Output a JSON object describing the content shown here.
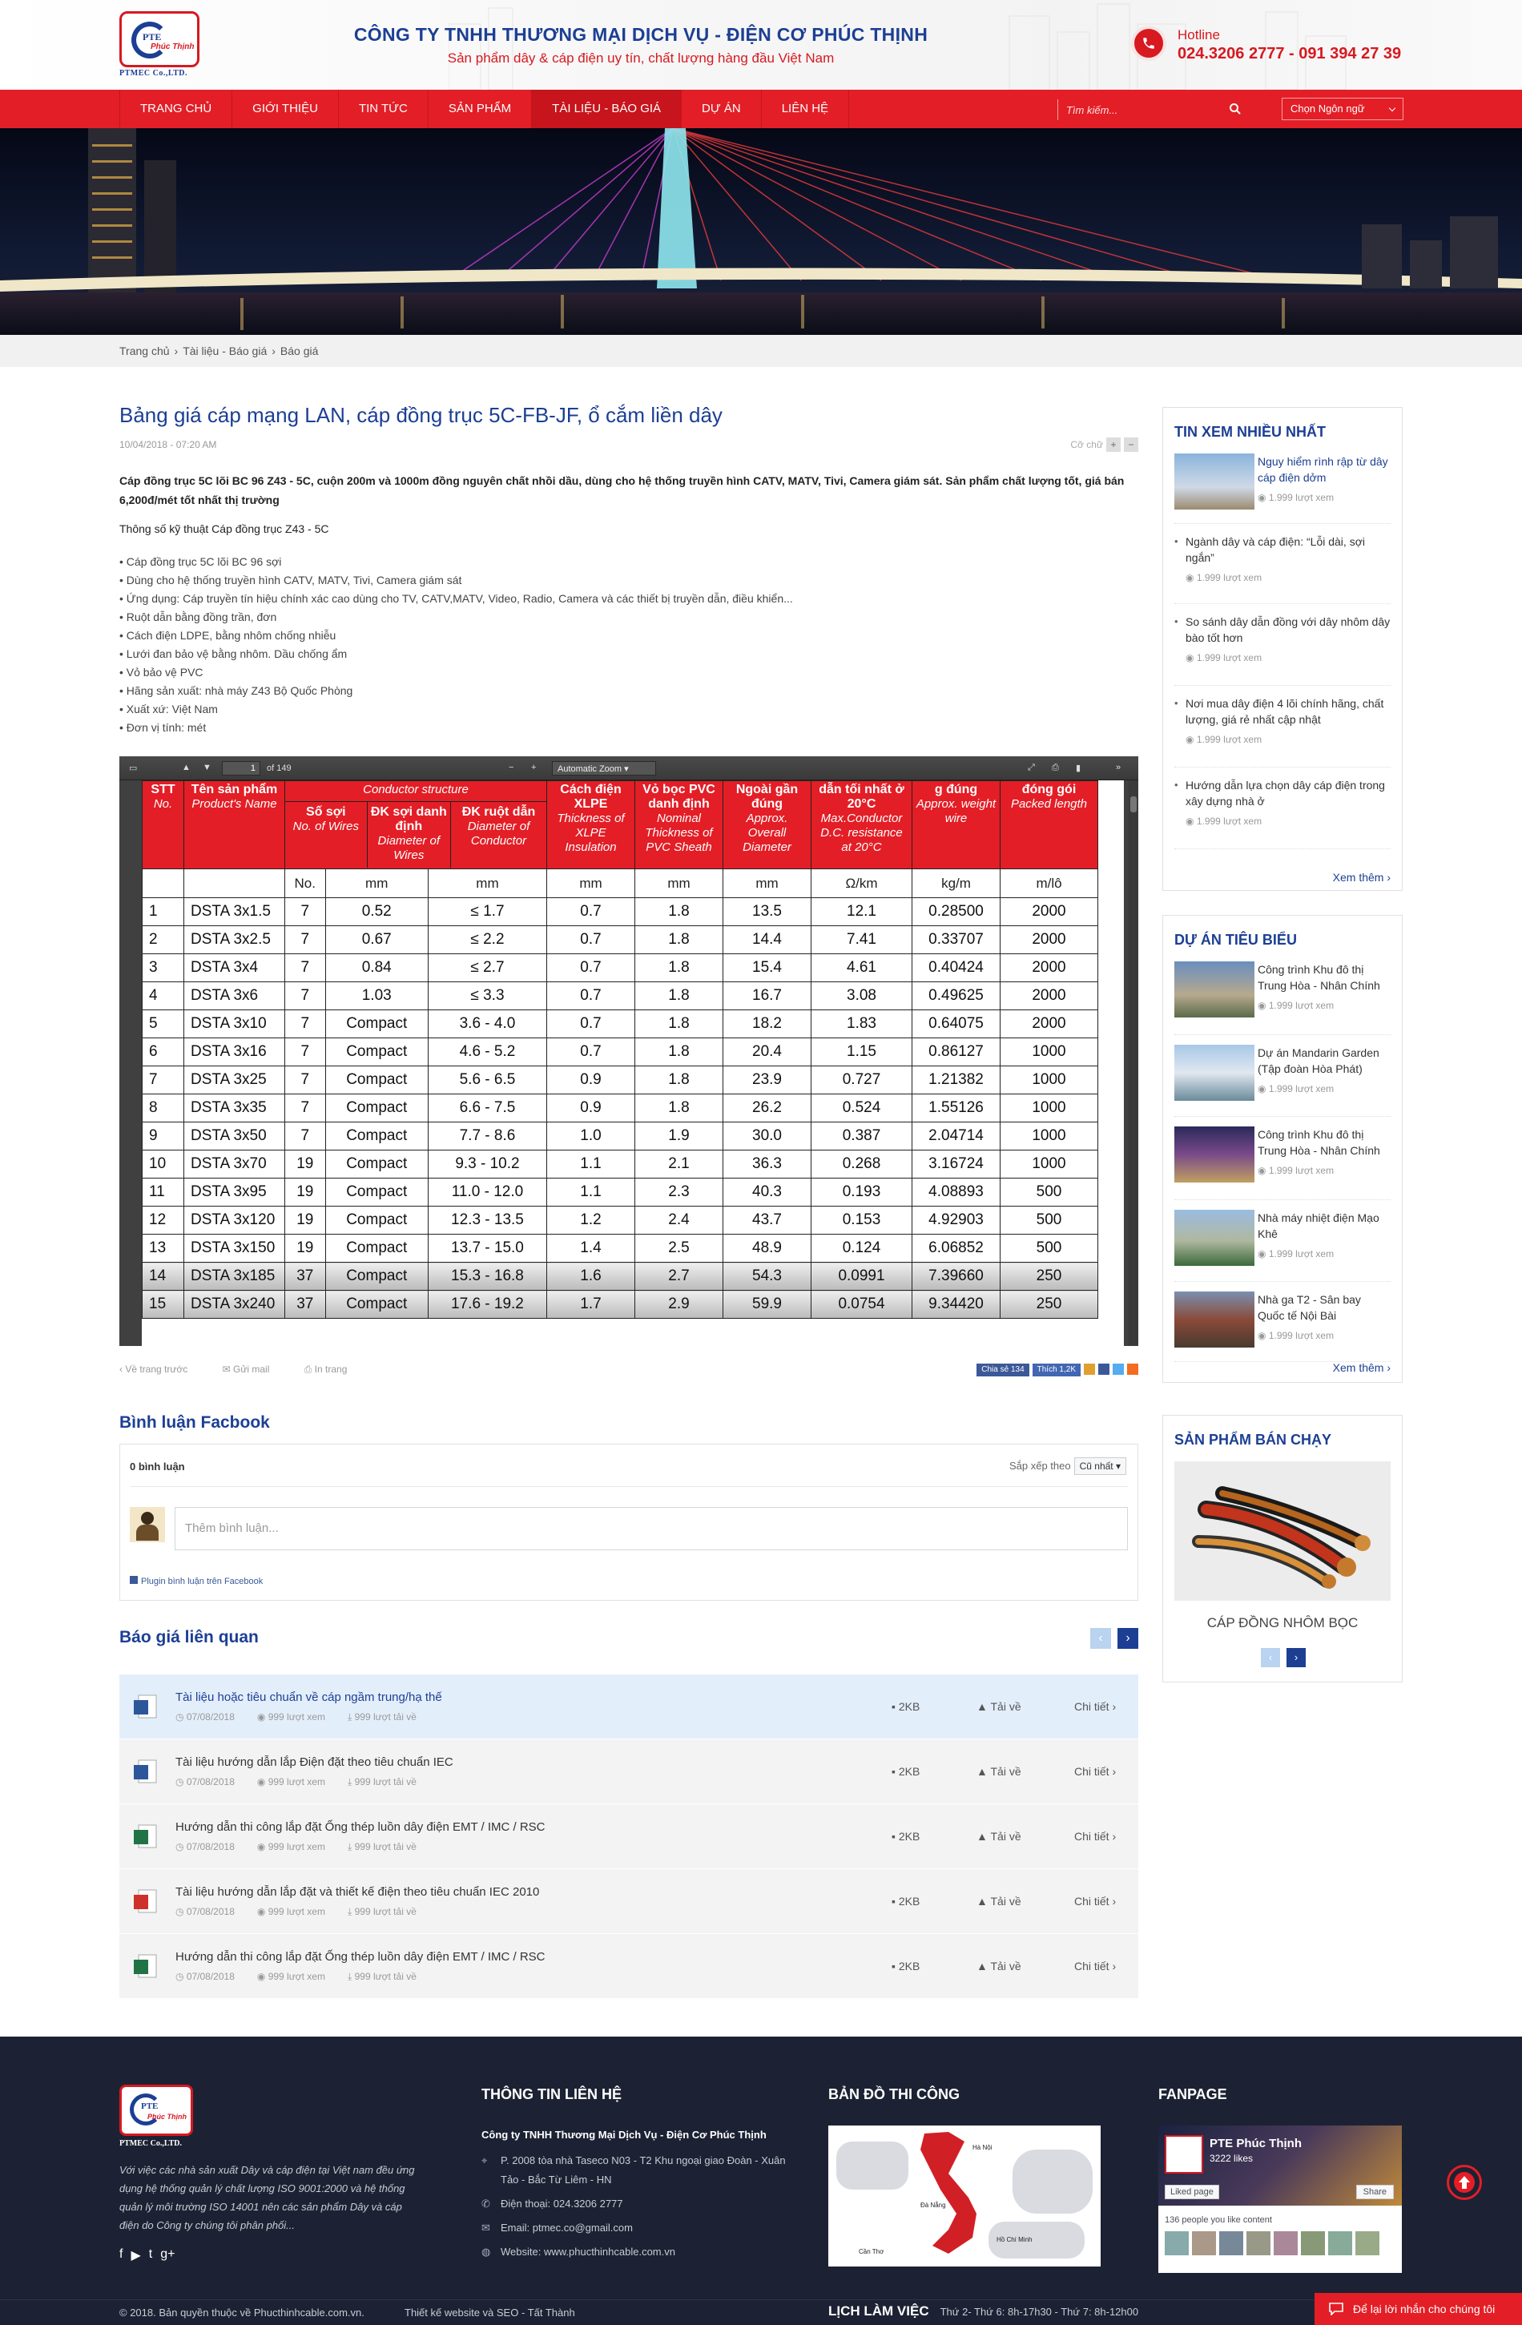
{
  "header": {
    "logo_name": "PTE",
    "logo_sub": "Phúc Thịnh",
    "logo_caption": "PTMEC Co.,LTD.",
    "company_name": "CÔNG TY TNHH THƯƠNG MẠI DỊCH VỤ - ĐIỆN CƠ PHÚC THỊNH",
    "slogan": "Sản phẩm dây & cáp điện uy tín, chất lượng hàng đầu Việt Nam",
    "hotline_label": "Hotline",
    "hotline_value": "024.3206 2777 - 091 394 27 39"
  },
  "nav": {
    "items": [
      {
        "label": "TRANG CHỦ"
      },
      {
        "label": "GIỚI THIỆU"
      },
      {
        "label": "TIN TỨC"
      },
      {
        "label": "SẢN PHẨM"
      },
      {
        "label": "TÀI LIỆU - BÁO GIÁ",
        "active": true
      },
      {
        "label": "DỰ ÁN"
      },
      {
        "label": "LIÊN HỆ"
      }
    ],
    "search_placeholder": "Tìm kiếm...",
    "language_label": "Chọn Ngôn ngữ"
  },
  "breadcrumb": [
    "Trang chủ",
    "Tài liệu - Báo giá",
    "Báo giá"
  ],
  "article": {
    "title": "Bảng giá cáp mạng LAN, cáp đồng trục 5C-FB-JF, ổ cắm liền dây",
    "date": "10/04/2018 - 07:20 AM",
    "font_size_label": "Cỡ chữ",
    "intro": "Cáp đồng trục 5C lõi BC 96 Z43 - 5C, cuộn 200m và 1000m đồng nguyên chất nhồi dầu, dùng cho hệ thống truyền hình CATV, MATV, Tivi, Camera giám sát. Sản phẩm chất lượng tốt, giá bán 6,200đ/mét tốt nhất thị trường",
    "spec_title": "Thông số kỹ thuật Cáp đồng trục Z43 - 5C",
    "bullets": [
      "Cáp đồng trục 5C lõi BC 96 sợi",
      "Dùng cho hệ thống truyền hình CATV, MATV, Tivi, Camera giám sát",
      "Ứng dụng: Cáp truyền tín hiệu chính xác cao dùng cho TV, CATV,MATV, Video, Radio, Camera và các thiết bị truyền dẫn, điều khiển...",
      "Ruột dẫn bằng đồng trần, đơn",
      "Cách điện LDPE, bằng nhôm chống nhiễu",
      "Lưới đan bảo vệ bằng nhôm. Dầu chống ẩm",
      "Vỏ bảo vệ PVC",
      "Hãng sản xuất: nhà máy Z43 Bộ Quốc Phòng",
      "Xuất xứ: Việt Nam",
      "Đơn vị tính: mét"
    ],
    "actions": {
      "back": "Về trang trước",
      "mail": "Gửi mail",
      "print": "In trang",
      "share": "Chia sẻ 134",
      "like": "Thích 1,2K"
    }
  },
  "pdf": {
    "page": "1",
    "of_pages": "of 149",
    "zoom": "Automatic Zoom",
    "headers": [
      {
        "vi": "STT",
        "en": "No."
      },
      {
        "vi": "Tên sản phẩm",
        "en": "Product's Name"
      },
      {
        "vi": "Conductor structure",
        "en": ""
      },
      {
        "vi": "Cách điện XLPE",
        "en": "Thickness of XLPE Insulation"
      },
      {
        "vi": "Vỏ bọc PVC danh định",
        "en": "Nominal Thickness of PVC Sheath"
      },
      {
        "vi": "Ngoài gần đúng",
        "en": "Approx. Overall Diameter"
      },
      {
        "vi": "dẫn tối nhất ở 20°C",
        "en": "Max.Conductor D.C. resistance at 20°C"
      },
      {
        "vi": "g đúng",
        "en": "Approx. weight wire"
      },
      {
        "vi": "đóng gói",
        "en": "Packed length"
      }
    ],
    "sub_headers": [
      {
        "vi": "Số sợi",
        "en": "No. of Wires"
      },
      {
        "vi": "ĐK sợi danh định",
        "en": "Diameter of Wires"
      },
      {
        "vi": "ĐK ruột dẫn",
        "en": "Diameter of Conductor"
      }
    ],
    "units": [
      "",
      "",
      "No.",
      "mm",
      "mm",
      "mm",
      "mm",
      "mm",
      "Ω/km",
      "kg/m",
      "m/lô"
    ],
    "rows": [
      [
        "1",
        "DSTA 3x1.5",
        "7",
        "0.52",
        "≤ 1.7",
        "0.7",
        "1.8",
        "13.5",
        "12.1",
        "0.28500",
        "2000"
      ],
      [
        "2",
        "DSTA 3x2.5",
        "7",
        "0.67",
        "≤ 2.2",
        "0.7",
        "1.8",
        "14.4",
        "7.41",
        "0.33707",
        "2000"
      ],
      [
        "3",
        "DSTA 3x4",
        "7",
        "0.84",
        "≤ 2.7",
        "0.7",
        "1.8",
        "15.4",
        "4.61",
        "0.40424",
        "2000"
      ],
      [
        "4",
        "DSTA 3x6",
        "7",
        "1.03",
        "≤ 3.3",
        "0.7",
        "1.8",
        "16.7",
        "3.08",
        "0.49625",
        "2000"
      ],
      [
        "5",
        "DSTA 3x10",
        "7",
        "Compact",
        "3.6 - 4.0",
        "0.7",
        "1.8",
        "18.2",
        "1.83",
        "0.64075",
        "2000"
      ],
      [
        "6",
        "DSTA 3x16",
        "7",
        "Compact",
        "4.6 - 5.2",
        "0.7",
        "1.8",
        "20.4",
        "1.15",
        "0.86127",
        "1000"
      ],
      [
        "7",
        "DSTA 3x25",
        "7",
        "Compact",
        "5.6 - 6.5",
        "0.9",
        "1.8",
        "23.9",
        "0.727",
        "1.21382",
        "1000"
      ],
      [
        "8",
        "DSTA 3x35",
        "7",
        "Compact",
        "6.6 - 7.5",
        "0.9",
        "1.8",
        "26.2",
        "0.524",
        "1.55126",
        "1000"
      ],
      [
        "9",
        "DSTA 3x50",
        "7",
        "Compact",
        "7.7 - 8.6",
        "1.0",
        "1.9",
        "30.0",
        "0.387",
        "2.04714",
        "1000"
      ],
      [
        "10",
        "DSTA 3x70",
        "19",
        "Compact",
        "9.3 - 10.2",
        "1.1",
        "2.1",
        "36.3",
        "0.268",
        "3.16724",
        "1000"
      ],
      [
        "11",
        "DSTA 3x95",
        "19",
        "Compact",
        "11.0 - 12.0",
        "1.1",
        "2.3",
        "40.3",
        "0.193",
        "4.08893",
        "500"
      ],
      [
        "12",
        "DSTA 3x120",
        "19",
        "Compact",
        "12.3 - 13.5",
        "1.2",
        "2.4",
        "43.7",
        "0.153",
        "4.92903",
        "500"
      ],
      [
        "13",
        "DSTA 3x150",
        "19",
        "Compact",
        "13.7 - 15.0",
        "1.4",
        "2.5",
        "48.9",
        "0.124",
        "6.06852",
        "500"
      ],
      [
        "14",
        "DSTA 3x185",
        "37",
        "Compact",
        "15.3 - 16.8",
        "1.6",
        "2.7",
        "54.3",
        "0.0991",
        "7.39660",
        "250"
      ],
      [
        "15",
        "DSTA 3x240",
        "37",
        "Compact",
        "17.6 - 19.2",
        "1.7",
        "2.9",
        "59.9",
        "0.0754",
        "9.34420",
        "250"
      ]
    ]
  },
  "comments": {
    "title": "Bình luận Facbook",
    "count": "0 bình luận",
    "sort_label": "Sắp xếp theo",
    "sort_value": "Cũ nhất",
    "placeholder": "Thêm bình luận...",
    "plugin": "Plugin bình luận trên Facebook"
  },
  "related": {
    "title": "Báo giá liên quan",
    "items": [
      {
        "icon": "word-file-icon",
        "title": "Tài liệu hoặc tiêu chuẩn về cáp ngầm trung/hạ thế",
        "date": "07/08/2018",
        "views": "999 lượt xem",
        "downloads": "999 lượt tải về",
        "size": "2KB",
        "download": "Tải về",
        "detail": "Chi tiết"
      },
      {
        "icon": "word-file-icon",
        "title": "Tài liệu hướng dẫn lắp Điện đặt theo tiêu chuẩn IEC",
        "date": "07/08/2018",
        "views": "999 lượt xem",
        "downloads": "999 lượt tải về",
        "size": "2KB",
        "download": "Tải về",
        "detail": "Chi tiết"
      },
      {
        "icon": "excel-file-icon",
        "title": "Hướng dẫn thi công lắp đặt Ống thép luồn dây điện EMT / IMC / RSC",
        "date": "07/08/2018",
        "views": "999 lượt xem",
        "downloads": "999 lượt tải về",
        "size": "2KB",
        "download": "Tải về",
        "detail": "Chi tiết"
      },
      {
        "icon": "pdf-file-icon",
        "title": "Tài liệu hướng dẫn lắp đặt và thiết kế điện theo tiêu chuẩn IEC 2010",
        "date": "07/08/2018",
        "views": "999 lượt xem",
        "downloads": "999 lượt tải về",
        "size": "2KB",
        "download": "Tải về",
        "detail": "Chi tiết"
      },
      {
        "icon": "excel-file-icon",
        "title": "Hướng dẫn thi công lắp đặt Ống thép luồn dây điện EMT / IMC / RSC",
        "date": "07/08/2018",
        "views": "999 lượt xem",
        "downloads": "999 lượt tải về",
        "size": "2KB",
        "download": "Tải về",
        "detail": "Chi tiết"
      }
    ]
  },
  "sidebar": {
    "most_viewed": {
      "title": "TIN XEM NHIỀU NHẤT",
      "items": [
        {
          "title": "Nguy hiểm rình rập từ dây cáp điện dởm",
          "views": "1.999 lượt xem"
        },
        {
          "title": "Ngành dây và cáp điện: “Lỗi dài, sợi ngắn”",
          "views": "1.999 lượt xem"
        },
        {
          "title": "So sánh dây dẫn đồng với dây nhôm dây bào tốt hơn",
          "views": "1.999 lượt xem"
        },
        {
          "title": "Nơi mua dây điện 4 lõi chính hãng, chất lượng, giá rẻ nhất cập nhật",
          "views": "1.999 lượt xem"
        },
        {
          "title": "Hướng dẫn lựa chọn dây cáp điện trong xây dựng nhà ở",
          "views": "1.999 lượt xem"
        }
      ],
      "more": "Xem thêm ›"
    },
    "projects": {
      "title": "DỰ ÁN TIÊU BIỂU",
      "items": [
        {
          "title": "Công trình Khu đô thị Trung Hòa - Nhân Chính",
          "views": "1.999 lượt xem"
        },
        {
          "title": "Dự án Mandarin Garden (Tập đoàn Hòa Phát)",
          "views": "1.999 lượt xem"
        },
        {
          "title": "Công trình Khu đô thị Trung Hòa - Nhân Chính",
          "views": "1.999 lượt xem"
        },
        {
          "title": "Nhà máy nhiệt điện Mạo Khê",
          "views": "1.999 lượt xem"
        },
        {
          "title": "Nhà ga T2 - Sân bay Quốc tế Nội Bài",
          "views": "1.999 lượt xem"
        }
      ],
      "more": "Xem thêm ›"
    },
    "best_sellers": {
      "title": "SẢN PHẨM BÁN CHẠY",
      "product": "CÁP ĐỒNG NHÔM BỌC"
    }
  },
  "footer": {
    "about": "Với việc các nhà sản xuất Dây và cáp điện tại Việt nam đều ứng dụng hệ thống quản lý chất lượng ISO 9001:2000 và hệ thống quản lý môi trường ISO 14001 nên các sản phẩm Dây và cáp điện do Công ty chúng tôi phân phối...",
    "contact_title": "THÔNG TIN LIÊN HỆ",
    "contact_company": "Công ty TNHH Thương Mại Dịch Vụ - Điện Cơ Phúc Thịnh",
    "address": "P. 2008 tòa nhà Taseco N03 - T2 Khu ngoại giao Đoàn - Xuân Tảo - Bắc Từ Liêm - HN",
    "phone": "Điện thoại: 024.3206 2777",
    "email": "Email: ptmec.co@gmail.com",
    "website": "Website: www.phucthinhcable.com.vn",
    "map_title": "BẢN ĐỒ THI CÔNG",
    "map_labels": [
      "Hà Nội",
      "Đà Nẵng",
      "Hồ Chí Minh",
      "Cần Thơ"
    ],
    "fanpage_title": "FANPAGE",
    "fan_name": "PTE Phúc Thịnh",
    "fan_likes": "3222 likes",
    "fan_liked": "Liked page",
    "fan_share": "Share",
    "fan_people": "136 people you like content",
    "copyright": "© 2018. Bản quyền thuộc về Phucthinhcable.com.vn.",
    "design": "Thiết kế website và SEO - Tất Thành",
    "schedule_title": "LỊCH LÀM VIỆC",
    "schedule": "Thứ 2- Thứ 6: 8h-17h30 - Thứ 7: 8h-12h00",
    "message": "Để lại lời nhắn cho chúng tôi"
  }
}
